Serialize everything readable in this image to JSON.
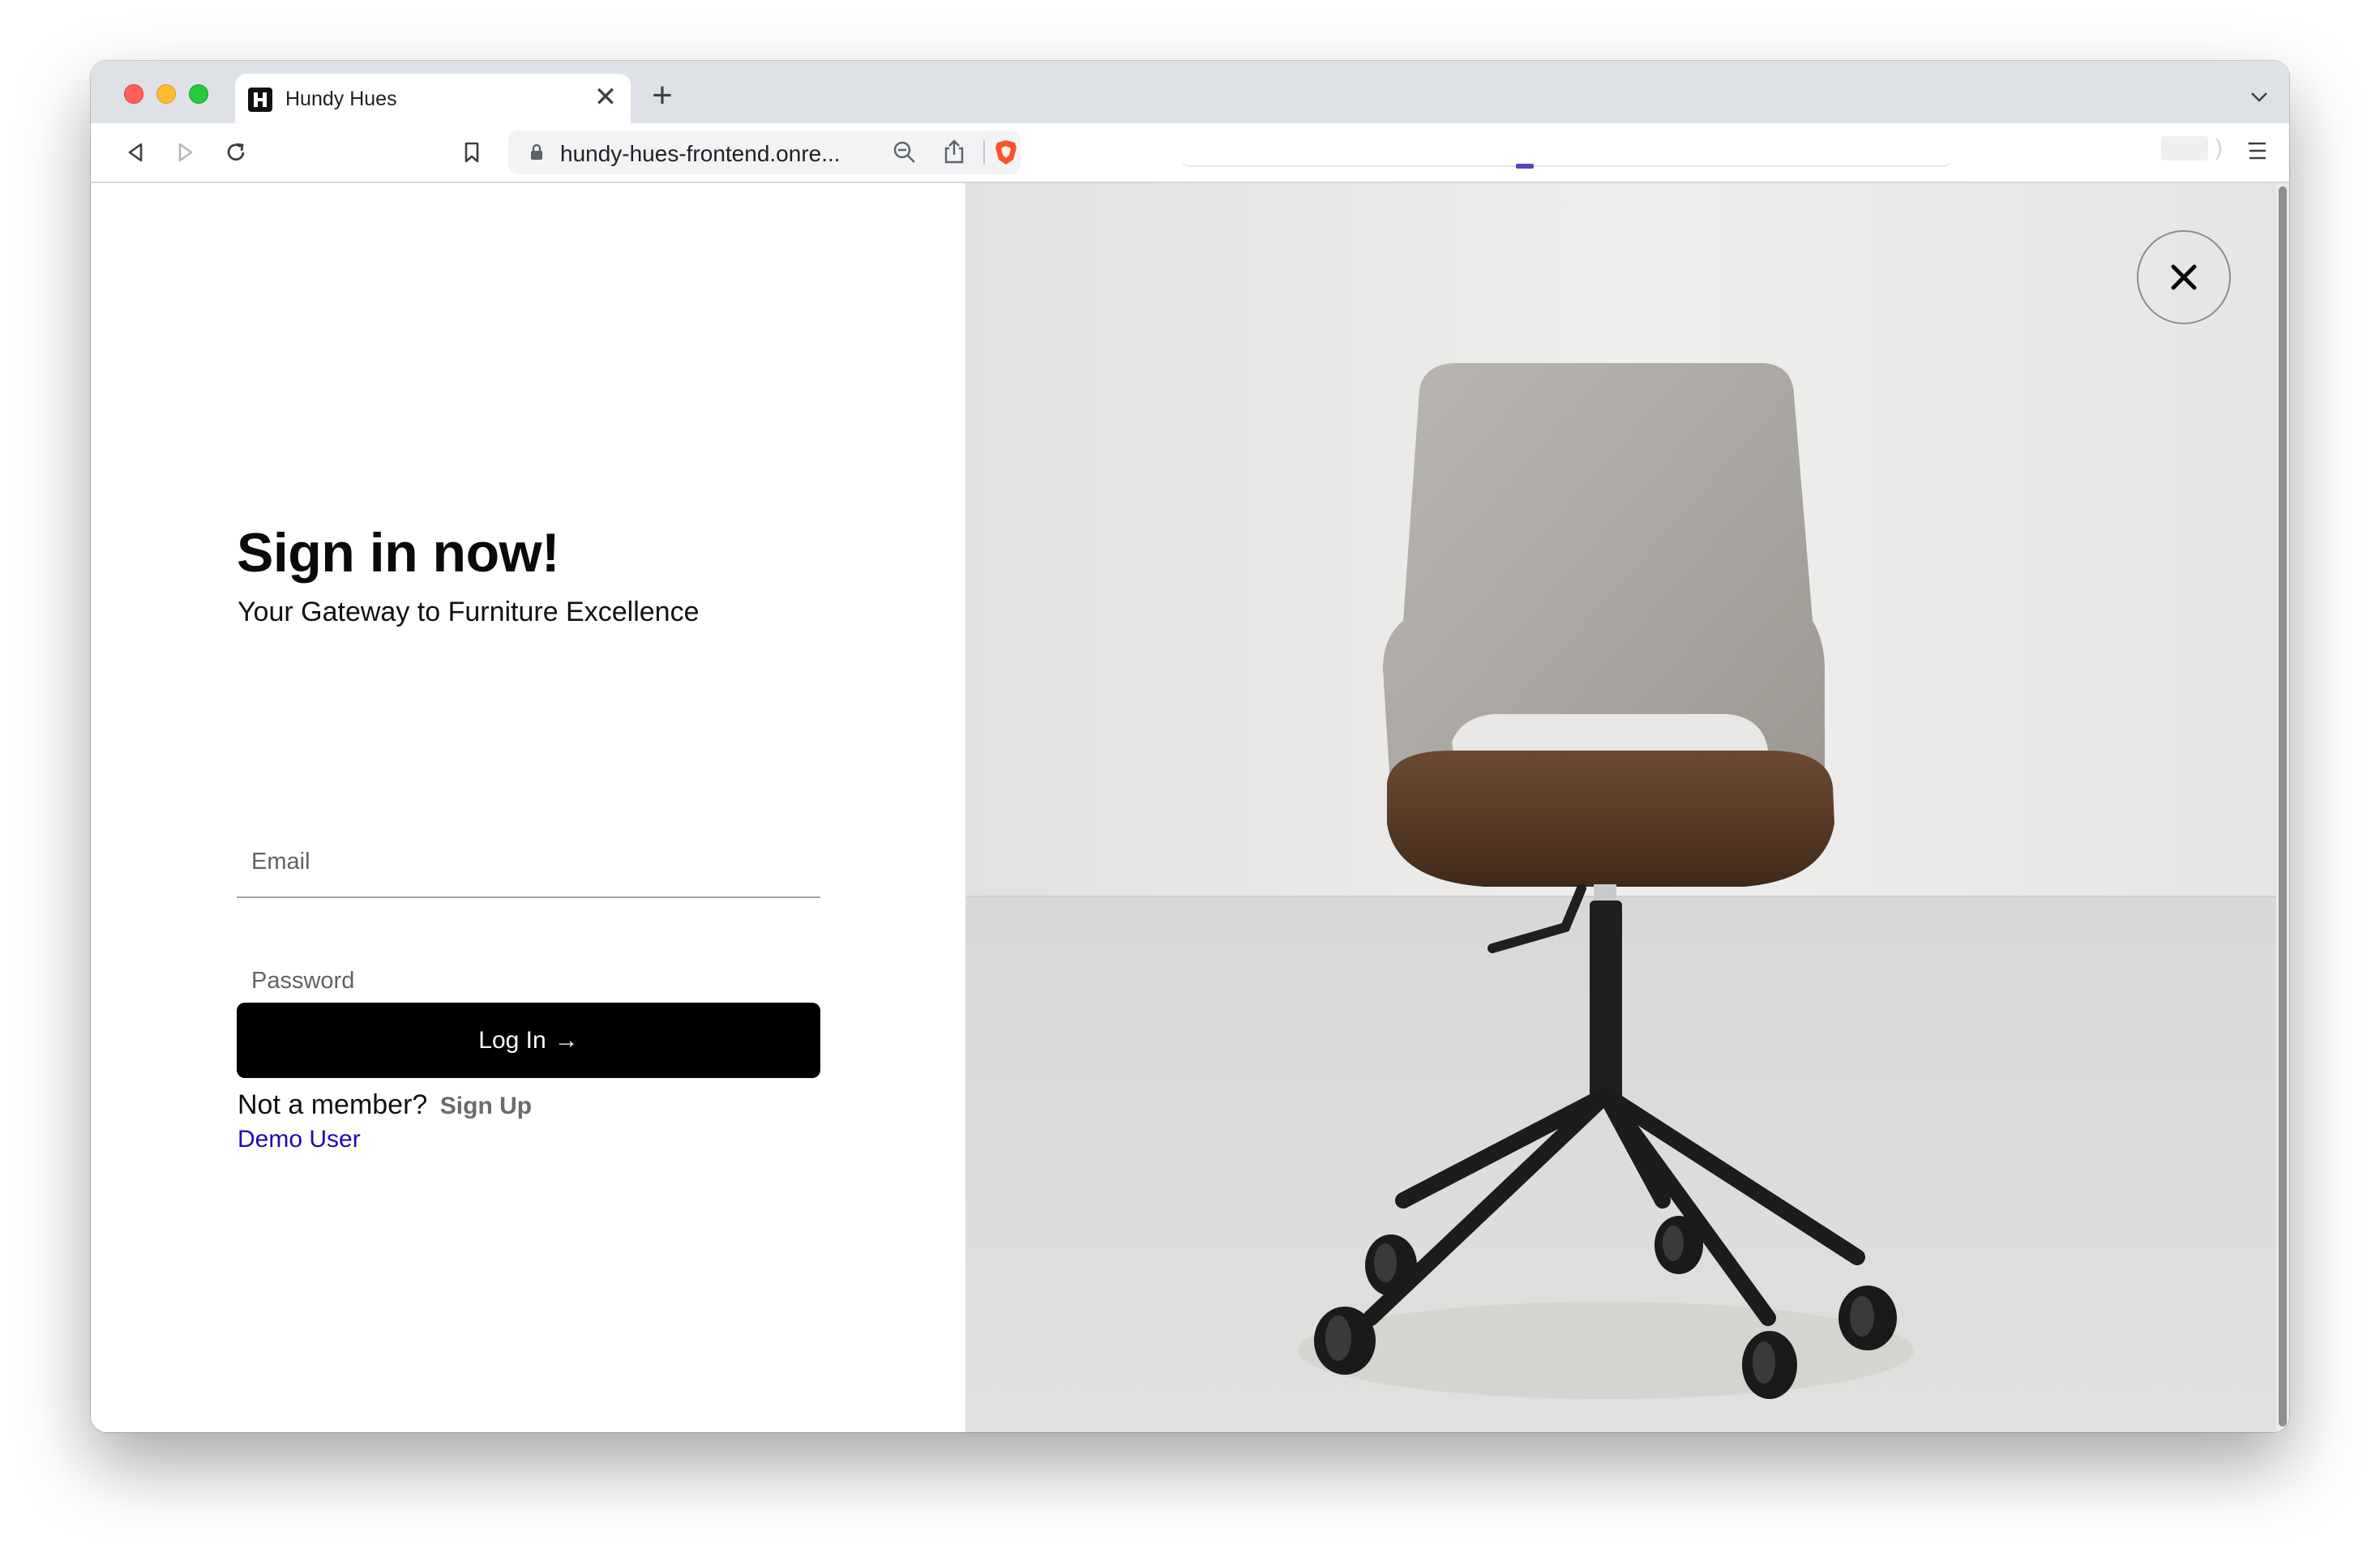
{
  "browser": {
    "tab_title": "Hundy Hues",
    "tab_close_symbol": "✕",
    "new_tab_symbol": "+",
    "url_display": "hundy-hues-frontend.onre..."
  },
  "login": {
    "heading": "Sign in now!",
    "subheading": "Your Gateway to Furniture Excellence",
    "email_placeholder": "Email",
    "email_value": "",
    "password_placeholder": "Password",
    "password_value": "",
    "button_label": "Log In",
    "button_arrow": "→",
    "member_prompt": "Not a member?",
    "signup_label": "Sign Up",
    "demo_label": "Demo User"
  },
  "hero": {
    "image_subject": "office-chair-photo",
    "close_label": "close"
  },
  "colors": {
    "button_bg": "#000000",
    "demo_link": "#1a0dab",
    "signup_link": "#6b6b6b",
    "photo_bg": "#e9e8e6"
  }
}
